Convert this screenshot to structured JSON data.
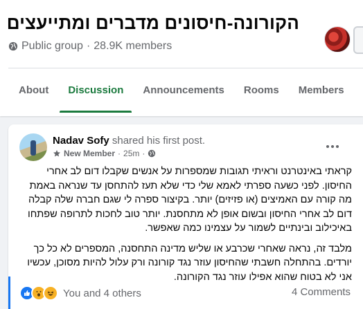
{
  "group": {
    "title": "הקורונה-חיסונים מדברים ומתייעצים",
    "privacy": "Public group",
    "separator": "·",
    "members": "28.9K members"
  },
  "tabs": [
    "About",
    "Discussion",
    "Announcements",
    "Rooms",
    "Members"
  ],
  "active_tab": "Discussion",
  "post": {
    "author": "Nadav Sofy",
    "action": "shared his first post.",
    "badge": "New Member",
    "dot": "·",
    "time": "25m",
    "dot2": "·",
    "paragraphs": [
      "קראתי באינטרנט וראיתי תגובות שמספרות על אנשים שקבלו דום לב אחרי החיסון. לפני כשעה ספרתי לאמא שלי כדי שלא תעז להתחסן עד שנראה באמת מה קורה עם האמיצים (או פזיזים) יותר. בקיצור ספרה לי שגם חברה שלה קבלה דום לב אחרי החיסון ובשום אופן לא מתחסנת. יותר טוב לחכות לתרופה שפתחו באיכילוב ובינתיים לשמור על עצמינו כמה שאפשר.",
      "מלבד זה, נראה שאחרי שכרבע או שליש מדינה התחסנה, המספרים לא כל כך יורדים. בהתחלה חשבתי שהחיסון עוזר נגד קורונה ורק עלול להיות מסוכן, עכשיו אני לא בטוח שהוא אפילו עוזר נגד הקורונה."
    ],
    "reactions_text": "You and 4 others",
    "comments": "4 Comments"
  },
  "colors": {
    "accent": "#1b7a3e",
    "like_blue": "#1877f2",
    "secondary_text": "#65676b"
  },
  "icons": [
    "globe-icon",
    "new-member-icon",
    "public-audience-icon",
    "more-icon",
    "like-reaction-icon",
    "haha-reaction-icon",
    "wow-reaction-icon"
  ]
}
